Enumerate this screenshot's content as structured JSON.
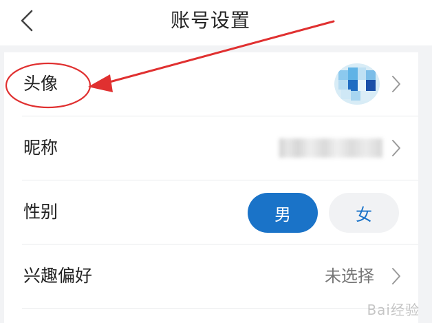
{
  "header": {
    "title": "账号设置",
    "back_icon": "chevron-left-icon"
  },
  "rows": [
    {
      "label": "头像",
      "value_type": "avatar"
    },
    {
      "label": "昵称",
      "value_type": "blurred-text"
    },
    {
      "label": "性别",
      "options": [
        "男",
        "女"
      ],
      "selected": "男"
    },
    {
      "label": "兴趣偏好",
      "value": "未选择"
    }
  ],
  "watermark": "Bai经验",
  "colors": {
    "accent": "#1a73c8",
    "annotation": "#e03030",
    "background": "#f2f3f5"
  }
}
